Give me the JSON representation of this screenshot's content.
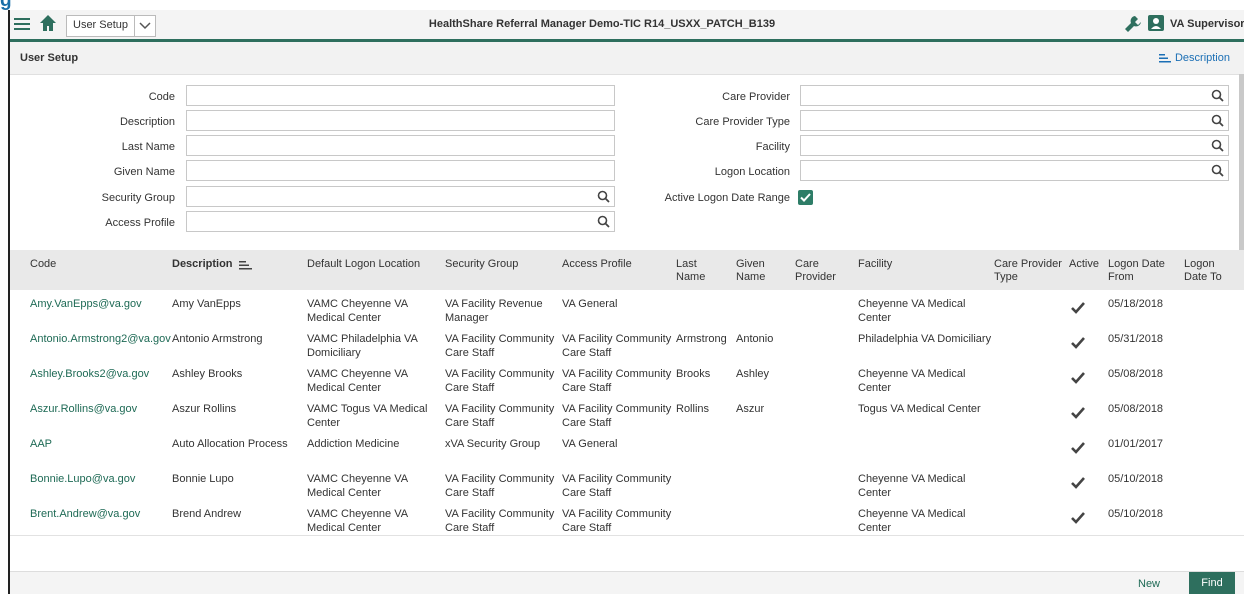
{
  "header": {
    "breadcrumb": "User Setup",
    "app_title": "HealthShare Referral Manager Demo-TIC R14_USXX_PATCH_B139",
    "user_name": "VA Supervisor"
  },
  "page": {
    "title": "User Setup",
    "description_link": "Description"
  },
  "form": {
    "code": {
      "label": "Code",
      "value": ""
    },
    "description": {
      "label": "Description",
      "value": ""
    },
    "last_name": {
      "label": "Last Name",
      "value": ""
    },
    "given_name": {
      "label": "Given Name",
      "value": ""
    },
    "security_group": {
      "label": "Security Group",
      "value": ""
    },
    "access_profile": {
      "label": "Access Profile",
      "value": ""
    },
    "care_provider": {
      "label": "Care Provider",
      "value": ""
    },
    "care_provider_type": {
      "label": "Care Provider Type",
      "value": ""
    },
    "facility": {
      "label": "Facility",
      "value": ""
    },
    "logon_location": {
      "label": "Logon Location",
      "value": ""
    },
    "active_logon_date_range": {
      "label": "Active Logon Date Range",
      "checked": true
    }
  },
  "table": {
    "columns": {
      "code": "Code",
      "description": "Description",
      "default_logon_location": "Default Logon Location",
      "security_group": "Security Group",
      "access_profile": "Access Profile",
      "last_name_1": "Last",
      "last_name_2": "Name",
      "given_name_1": "Given",
      "given_name_2": "Name",
      "care_provider_1": "Care",
      "care_provider_2": "Provider",
      "facility": "Facility",
      "care_provider_type_1": "Care Provider",
      "care_provider_type_2": "Type",
      "active": "Active",
      "logon_from_1": "Logon Date",
      "logon_from_2": "From",
      "logon_to_1": "Logon",
      "logon_to_2": "Date To"
    },
    "rows": [
      {
        "code": "Amy.VanEpps@va.gov",
        "description": "Amy VanEpps",
        "loc1": "VAMC Cheyenne VA",
        "loc2": "Medical Center",
        "sg1": "VA Facility Revenue",
        "sg2": "Manager",
        "ap1": "VA General",
        "ap2": "",
        "last": "",
        "given": "",
        "provider": "",
        "fac1": "Cheyenne VA Medical",
        "fac2": "Center",
        "type": "",
        "active": true,
        "from": "05/18/2018",
        "to": ""
      },
      {
        "code": "Antonio.Armstrong2@va.gov",
        "description": "Antonio Armstrong",
        "loc1": "VAMC Philadelphia VA",
        "loc2": "Domiciliary",
        "sg1": "VA Facility Community",
        "sg2": "Care Staff",
        "ap1": "VA Facility Community",
        "ap2": "Care Staff",
        "last": "Armstrong",
        "given": "Antonio",
        "provider": "",
        "fac1": "Philadelphia VA Domiciliary",
        "fac2": "",
        "type": "",
        "active": true,
        "from": "05/31/2018",
        "to": ""
      },
      {
        "code": "Ashley.Brooks2@va.gov",
        "description": "Ashley Brooks",
        "loc1": "VAMC Cheyenne VA",
        "loc2": "Medical Center",
        "sg1": "VA Facility Community",
        "sg2": "Care Staff",
        "ap1": "VA Facility Community",
        "ap2": "Care Staff",
        "last": "Brooks",
        "given": "Ashley",
        "provider": "",
        "fac1": "Cheyenne VA Medical",
        "fac2": "Center",
        "type": "",
        "active": true,
        "from": "05/08/2018",
        "to": ""
      },
      {
        "code": "Aszur.Rollins@va.gov",
        "description": "Aszur Rollins",
        "loc1": "VAMC Togus VA Medical",
        "loc2": "Center",
        "sg1": "VA Facility Community",
        "sg2": "Care Staff",
        "ap1": "VA Facility Community",
        "ap2": "Care Staff",
        "last": "Rollins",
        "given": "Aszur",
        "provider": "",
        "fac1": "Togus VA Medical Center",
        "fac2": "",
        "type": "",
        "active": true,
        "from": "05/08/2018",
        "to": ""
      },
      {
        "code": "AAP",
        "description": "Auto Allocation Process",
        "loc1": "Addiction Medicine",
        "loc2": "",
        "sg1": "xVA Security Group",
        "sg2": "",
        "ap1": "VA General",
        "ap2": "",
        "last": "",
        "given": "",
        "provider": "",
        "fac1": "",
        "fac2": "",
        "type": "",
        "active": true,
        "from": "01/01/2017",
        "to": ""
      },
      {
        "code": "Bonnie.Lupo@va.gov",
        "description": "Bonnie Lupo",
        "loc1": "VAMC Cheyenne VA",
        "loc2": "Medical Center",
        "sg1": "VA Facility Community",
        "sg2": "Care Staff",
        "ap1": "VA Facility Community",
        "ap2": "Care Staff",
        "last": "",
        "given": "",
        "provider": "",
        "fac1": "Cheyenne VA Medical",
        "fac2": "Center",
        "type": "",
        "active": true,
        "from": "05/10/2018",
        "to": ""
      },
      {
        "code": "Brent.Andrew@va.gov",
        "description": "Brend Andrew",
        "loc1": "VAMC Cheyenne VA",
        "loc2": "Medical Center",
        "sg1": "VA Facility Community",
        "sg2": "Care Staff",
        "ap1": "VA Facility Community",
        "ap2": "Care Staff",
        "last": "",
        "given": "",
        "provider": "",
        "fac1": "Cheyenne VA Medical",
        "fac2": "Center",
        "type": "",
        "active": true,
        "from": "05/10/2018",
        "to": ""
      }
    ]
  },
  "footer": {
    "new_label": "New",
    "find_label": "Find"
  },
  "colors": {
    "accent": "#2e6f5e",
    "link": "#1e6a55",
    "description_link": "#1b6fb5"
  },
  "icons": [
    "hamburger-icon",
    "home-icon",
    "chevron-down-icon",
    "wrench-icon",
    "user-icon",
    "sort-icon",
    "search-icon",
    "checkmark-icon"
  ]
}
